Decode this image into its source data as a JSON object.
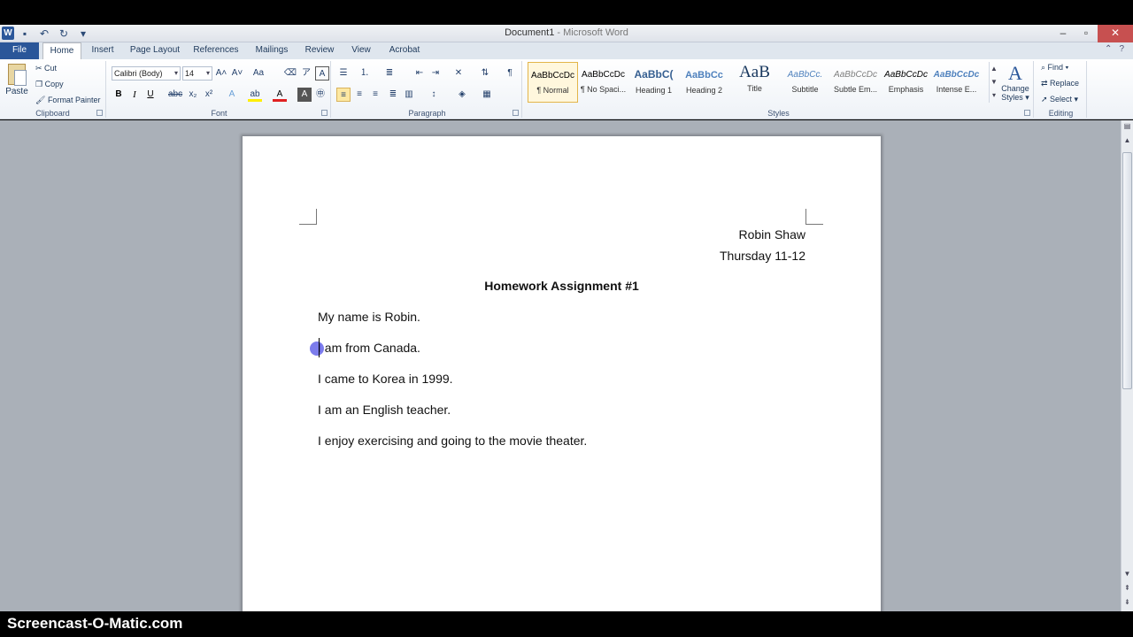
{
  "window": {
    "title_doc": "Document1",
    "title_sep": " - ",
    "title_app": "Microsoft Word"
  },
  "tabs": [
    {
      "label": "File"
    },
    {
      "label": "Home"
    },
    {
      "label": "Insert"
    },
    {
      "label": "Page Layout"
    },
    {
      "label": "References"
    },
    {
      "label": "Mailings"
    },
    {
      "label": "Review"
    },
    {
      "label": "View"
    },
    {
      "label": "Acrobat"
    }
  ],
  "clipboard": {
    "paste": "Paste",
    "cut": "Cut",
    "copy": "Copy",
    "format_painter": "Format Painter",
    "group": "Clipboard"
  },
  "font": {
    "name": "Calibri (Body)",
    "size": "14",
    "group": "Font"
  },
  "paragraph": {
    "group": "Paragraph"
  },
  "styles": {
    "group": "Styles",
    "items": [
      {
        "preview": "AaBbCcDc",
        "name": "¶ Normal"
      },
      {
        "preview": "AaBbCcDc",
        "name": "¶ No Spaci..."
      },
      {
        "preview": "AaBbC(",
        "name": "Heading 1"
      },
      {
        "preview": "AaBbCc",
        "name": "Heading 2"
      },
      {
        "preview": "AaB",
        "name": "Title"
      },
      {
        "preview": "AaBbCc.",
        "name": "Subtitle"
      },
      {
        "preview": "AaBbCcDc",
        "name": "Subtle Em..."
      },
      {
        "preview": "AaBbCcDc",
        "name": "Emphasis"
      },
      {
        "preview": "AaBbCcDc",
        "name": "Intense E..."
      }
    ],
    "change_styles_line1": "Change",
    "change_styles_line2": "Styles ▾"
  },
  "editing": {
    "find": "Find ▾",
    "replace": "Replace",
    "select": "Select ▾",
    "group": "Editing"
  },
  "document": {
    "author": "Robin Shaw",
    "class_time": "Thursday 11-12",
    "heading": "Homework Assignment #1",
    "lines": [
      "My name is Robin.",
      "I am from Canada.",
      "I came to Korea in 1999.",
      "I am an English teacher.",
      "I enjoy exercising and going to the movie theater."
    ]
  },
  "watermark": "Screencast-O-Matic.com",
  "colors": {
    "file_tab": "#2a5699",
    "page": "#ffffff",
    "doc_background": "#aab0b8"
  }
}
